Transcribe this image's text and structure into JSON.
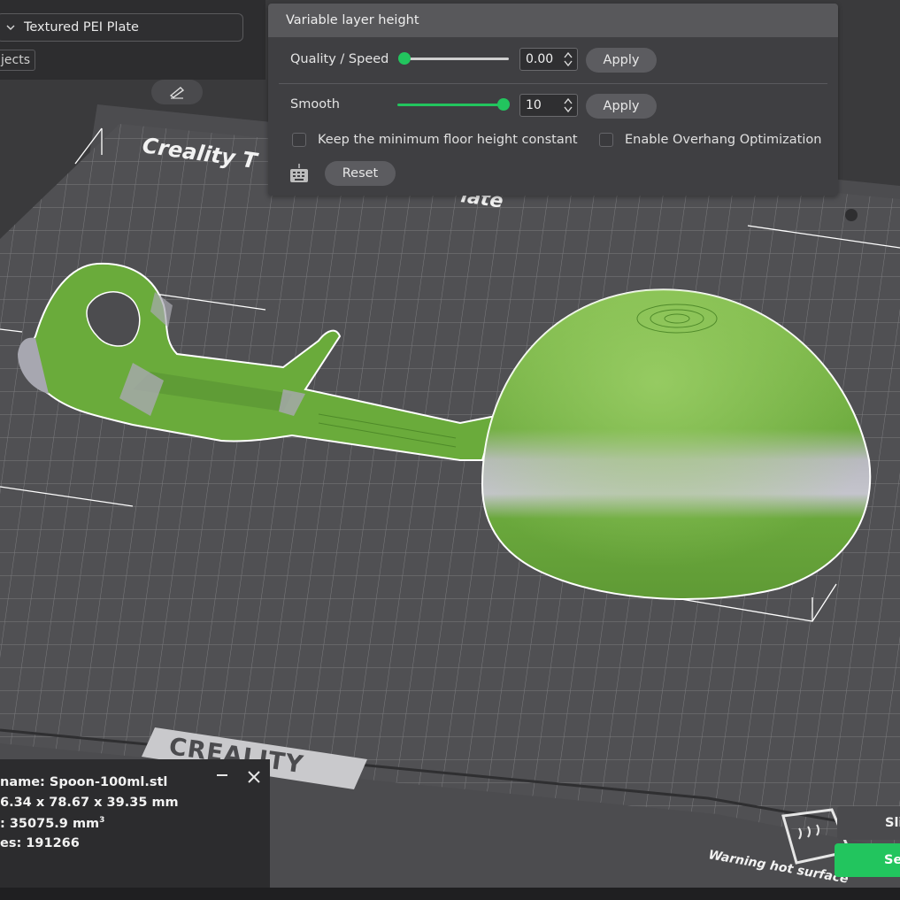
{
  "plate_selector": {
    "label": "Textured PEI Plate"
  },
  "objects_tab": {
    "label": "jects"
  },
  "layer_panel": {
    "title": "Variable layer height",
    "quality_speed": {
      "label": "Quality / Speed",
      "value": "0.00",
      "apply_label": "Apply",
      "slider_level": 0.0
    },
    "smooth": {
      "label": "Smooth",
      "value": "10",
      "apply_label": "Apply",
      "slider_level": 1.0
    },
    "keep_floor": {
      "label": "Keep the minimum floor height constant",
      "checked": false
    },
    "overhang": {
      "label": "Enable Overhang Optimization",
      "checked": false
    },
    "reset_label": "Reset"
  },
  "bed": {
    "brand_top": "Creality T",
    "brand_top_suffix": "late",
    "brand_bottom": "CREALITY",
    "warning": "Warning hot surface"
  },
  "model_info": {
    "line1": "name: Spoon-100ml.stl",
    "line2": "6.34 x 78.67 x 39.35 mm",
    "line3_prefix": ": 35075.9 mm",
    "line3_sup": "3",
    "line4": "es: 191266"
  },
  "actions": {
    "slice_label": "Sli",
    "send_label": "Se"
  },
  "colors": {
    "accent": "#22c55e",
    "model": "#6fb240",
    "bed": "#4d4d50"
  }
}
